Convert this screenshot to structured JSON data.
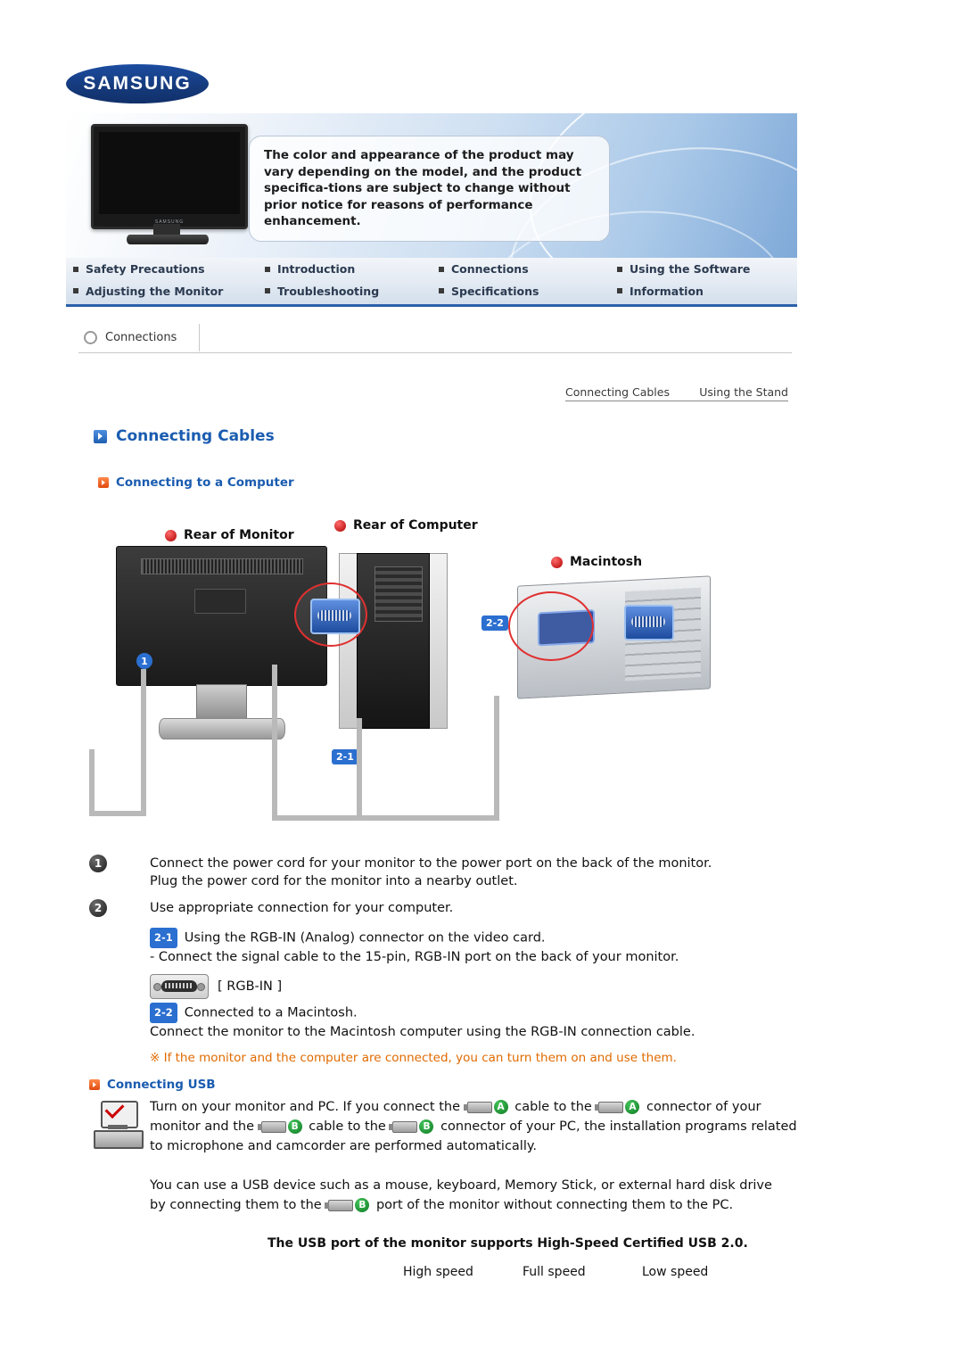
{
  "brand": {
    "logo_text": "SAMSUNG"
  },
  "banner": {
    "notice": "The color and appearance of the product may vary depending on the model, and the product specifica-tions are subject to change without prior notice for reasons of performance enhancement."
  },
  "nav": {
    "items": [
      "Safety Precautions",
      "Introduction",
      "Connections",
      "Using the Software",
      "Adjusting the Monitor",
      "Troubleshooting",
      "Specifications",
      "Information"
    ]
  },
  "section": {
    "tab_label": "Connections"
  },
  "subtabs": [
    "Connecting Cables",
    "Using the Stand"
  ],
  "headings": {
    "h1": "Connecting Cables",
    "h2_computer": "Connecting to a Computer",
    "h2_usb": "Connecting USB"
  },
  "diagram": {
    "label_monitor": "Rear of Monitor",
    "label_computer": "Rear of Computer",
    "label_mac": "Macintosh",
    "badge_2_1": "2-1",
    "badge_2_2": "2-2",
    "marker_1": "1"
  },
  "steps": {
    "one_marker": "1",
    "one_line1": "Connect the power cord for your monitor to the power port on the back of the monitor.",
    "one_line2": "Plug the power cord for the monitor into a nearby outlet.",
    "two_marker": "2",
    "two_line": "Use appropriate connection for your computer.",
    "badge_2_1": "2-1",
    "b21_line1": "Using the RGB-IN (Analog) connector on the video card.",
    "b21_line2": "- Connect the signal cable to the 15-pin, RGB-IN port on the back of your monitor.",
    "rgb_label": "[ RGB-IN ]",
    "badge_2_2": "2-2",
    "b22_line1": "Connected to a Macintosh.",
    "b22_line2": "Connect the monitor to the Macintosh computer using the RGB-IN connection cable.",
    "note": "※ If the monitor and the computer are connected, you can turn them on and use them."
  },
  "usb": {
    "p1_part1": "Turn on your monitor and PC. If you connect the",
    "p1_plugA1": "A",
    "p1_part2": "cable to the",
    "p1_plugA2": "A",
    "p1_part3": "connector of your",
    "p2_part1": "monitor and the",
    "p2_plugB1": "B",
    "p2_part2": "cable to the",
    "p2_plugB2": "B",
    "p2_part3": "connector of your PC, the installation programs related",
    "p3": "to microphone and camcorder are performed automatically.",
    "p4_line1": "You can use a USB device such as a mouse, keyboard, Memory Stick, or external hard disk drive",
    "p4_part1": "by connecting them to the",
    "p4_plugB": "B",
    "p4_part2": "port of the monitor without connecting them to the PC.",
    "bold_note": "The USB port of the monitor supports High-Speed Certified USB 2.0.",
    "speeds": [
      "High speed",
      "Full speed",
      "Low speed"
    ]
  },
  "colors": {
    "accent_blue": "#1a5cb0",
    "badge_blue": "#2b6fd0",
    "note_orange": "#e06a00",
    "usb_green": "#1a8a2e"
  }
}
